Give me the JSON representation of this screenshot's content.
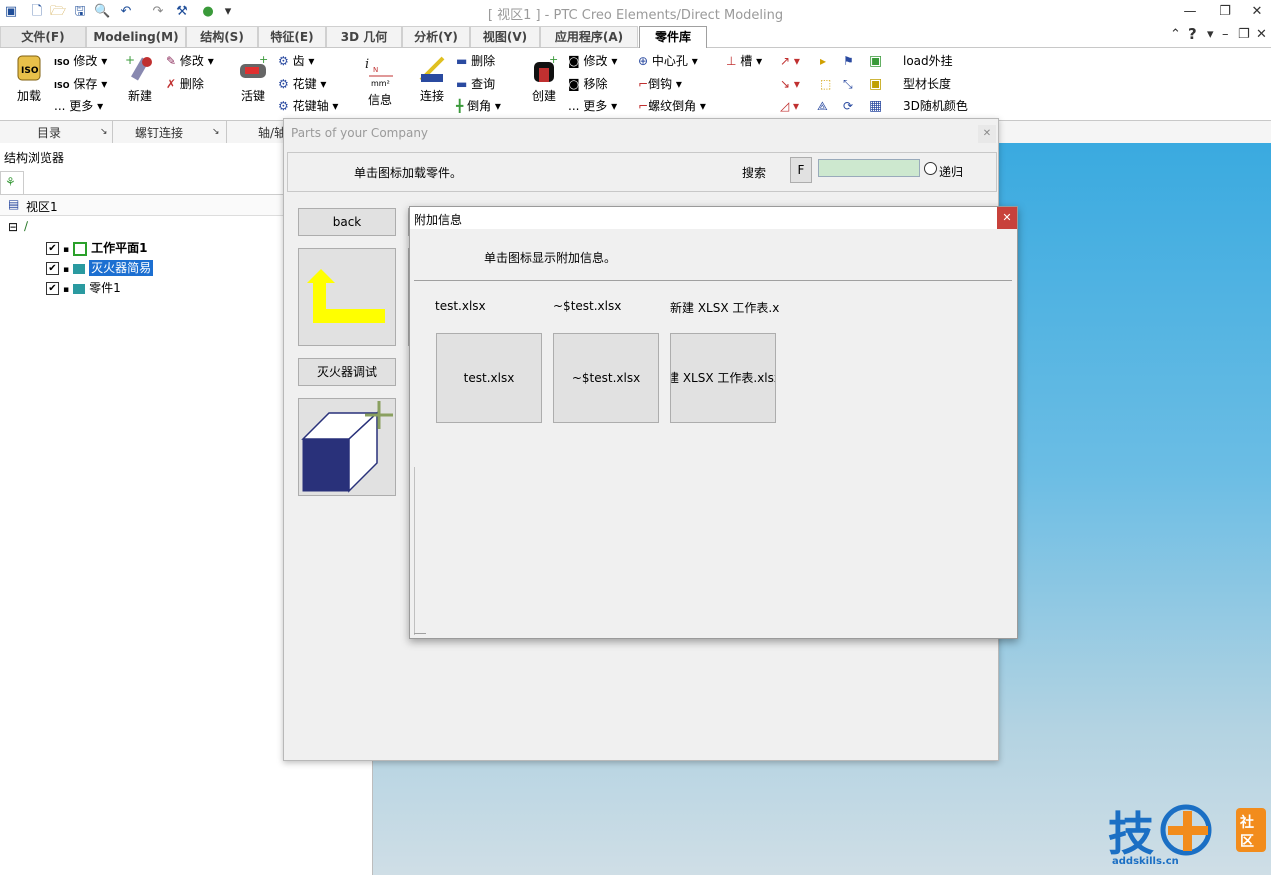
{
  "window": {
    "title": "[ 视区1 ] - PTC Creo Elements/Direct Modeling"
  },
  "ribbon_tabs": [
    {
      "label": "文件(F)"
    },
    {
      "label": "Modeling(M)"
    },
    {
      "label": "结构(S)"
    },
    {
      "label": "特征(E)"
    },
    {
      "label": "3D 几何"
    },
    {
      "label": "分析(Y)"
    },
    {
      "label": "视图(V)"
    },
    {
      "label": "应用程序(A)"
    },
    {
      "label": "零件库"
    }
  ],
  "active_tab": "零件库",
  "ribbon": {
    "load": "加载",
    "modify1": "修改",
    "save": "保存",
    "more1": "更多",
    "new": "新建",
    "modify2": "修改",
    "delete1": "删除",
    "key": "活键",
    "gear": "齿",
    "spline": "花键",
    "spline_shaft": "花键轴",
    "info": "信息",
    "connect": "连接",
    "delete2": "删除",
    "query": "查询",
    "chamfer1": "倒角",
    "create": "创建",
    "modify3": "修改",
    "move": "移除",
    "more2": "更多",
    "center_hole": "中心孔",
    "chamfer2": "倒钩",
    "thread_chamfer": "螺纹倒角",
    "slot": "槽",
    "load_external": "load外挂",
    "profile_length": "型材长度",
    "random_color": "3D随机颜色",
    "unit_n": "N",
    "unit_mm": "mm²"
  },
  "ribbon_groups": [
    "目录",
    "螺钉连接",
    "轴/轴"
  ],
  "browser": {
    "header": "结构浏览器",
    "view": "视区1",
    "items": [
      {
        "label": "工作平面1"
      },
      {
        "label": "灭火器简易"
      },
      {
        "label": "零件1"
      }
    ]
  },
  "parts_dialog": {
    "title": "Parts of your Company",
    "hint": "单击图标加载零件。",
    "search_label": "搜索",
    "search_button": "F",
    "search_value": "",
    "recursive_label": "递归",
    "back": "back",
    "fire_debug": "灭火器调试"
  },
  "info_dialog": {
    "title": "附加信息",
    "hint": "单击图标显示附加信息。",
    "files": [
      {
        "label": "test.xlsx",
        "button": "test.xlsx"
      },
      {
        "label": "~$test.xlsx",
        "button": "~$test.xlsx"
      },
      {
        "label": "新建 XLSX 工作表.x",
        "button": "新建 XLSX 工作表.xlsx"
      }
    ]
  },
  "watermark": {
    "logo_text": "技+社区",
    "url": "addskills.cn"
  },
  "colors": {
    "accent": "#1c6fd1",
    "close_red": "#c8413b",
    "viewport_top": "#3aaae0",
    "arrow_yellow": "#ffff00",
    "cube_navy": "#29317a"
  }
}
